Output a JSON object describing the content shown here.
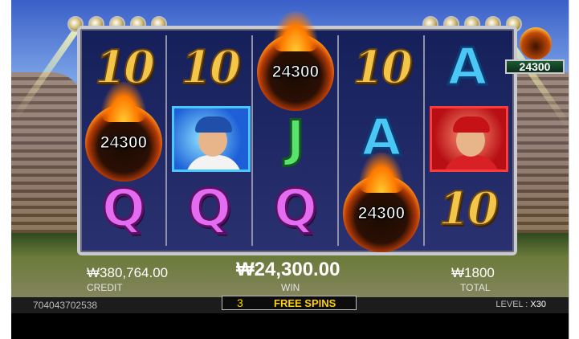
{
  "reels": [
    [
      "10",
      "fireball",
      "Q"
    ],
    [
      "10",
      "player-blue",
      "Q"
    ],
    [
      "fireball",
      "J",
      "Q"
    ],
    [
      "10",
      "A",
      "fireball"
    ],
    [
      "A",
      "player-red",
      "10"
    ]
  ],
  "fireballs": [
    "24300",
    "24300",
    "24300"
  ],
  "mini_multiplier": "24300",
  "credit": {
    "value": "₩380,764.00",
    "label": "CREDIT"
  },
  "win": {
    "value": "₩24,300.00",
    "label": "WIN"
  },
  "total": {
    "value": "₩1800",
    "label": "TOTAL"
  },
  "round_id": "704043702538",
  "free_spins": {
    "count": "3",
    "label": "FREE SPINS"
  },
  "level": {
    "label": "LEVEL :",
    "value": "X30"
  },
  "colors": {
    "gold": "#f3c64a",
    "queen": "#e36cf0",
    "jack": "#5ae36b",
    "ace": "#4bc7f5",
    "free_spins": "#ffd200"
  }
}
